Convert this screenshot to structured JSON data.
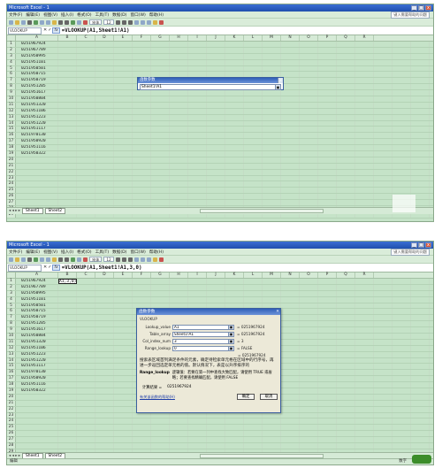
{
  "shot1": {
    "title": "Microsoft Excel - 1",
    "menu": [
      "文件(F)",
      "编辑(E)",
      "视图(V)",
      "插入(I)",
      "格式(O)",
      "工具(T)",
      "数据(D)",
      "窗口(W)",
      "帮助(H)"
    ],
    "help_box": "键入需要帮助的问题",
    "font_select": "宋体",
    "size_select": "12",
    "name_box": "VLOOKUP",
    "formula": "=VLOOKUP(A1,Sheet1!A1)",
    "columns": [
      "A",
      "B",
      "C",
      "D",
      "E",
      "F",
      "G",
      "H",
      "I",
      "J",
      "K",
      "L",
      "M",
      "N",
      "O",
      "P",
      "Q",
      "R"
    ],
    "rows": [
      "1",
      "2",
      "3",
      "4",
      "5",
      "6",
      "7",
      "8",
      "9",
      "10",
      "11",
      "12",
      "13",
      "14",
      "15",
      "16",
      "17",
      "18",
      "19",
      "20",
      "21",
      "22",
      "23",
      "24",
      "25",
      "26",
      "27",
      "28",
      "29",
      "30",
      "31",
      "32",
      "33"
    ],
    "cells_a": [
      "0251967924",
      "0251967789",
      "0251950995",
      "0251951101",
      "0251950501",
      "0251950715",
      "0251950719",
      "0251951205",
      "0251951617",
      "0251950804",
      "0251951320",
      "0251951106",
      "0251951223",
      "0251951220",
      "0251951117",
      "0251970130",
      "0251950920",
      "0251951116",
      "0251950322"
    ],
    "popup": {
      "title": "函数参数",
      "value": "Sheet1!A1"
    },
    "tabs": [
      "Sheet1",
      "Sheet2"
    ],
    "tab_nav": "◂ ◂ ▸ ▸"
  },
  "shot2": {
    "title": "Microsoft Excel - 1",
    "menu": [
      "文件(F)",
      "编辑(E)",
      "视图(V)",
      "插入(I)",
      "格式(O)",
      "工具(T)",
      "数据(D)",
      "窗口(W)",
      "帮助(H)"
    ],
    "help_box": "键入需要帮助的问题",
    "font_select": "宋体",
    "size_select": "12",
    "name_box": "VLOOKUP",
    "formula": "=VLOOKUP(A1,Sheet1!A1,3,0)",
    "active_cell_text": "A1,3,0)",
    "columns": [
      "A",
      "B",
      "C",
      "D",
      "E",
      "F",
      "G",
      "H",
      "I",
      "J",
      "K",
      "L",
      "M",
      "N",
      "O",
      "P",
      "Q",
      "R"
    ],
    "rows": [
      "1",
      "2",
      "3",
      "4",
      "5",
      "6",
      "7",
      "8",
      "9",
      "10",
      "11",
      "12",
      "13",
      "14",
      "15",
      "16",
      "17",
      "18",
      "19",
      "20",
      "21",
      "22",
      "23",
      "24",
      "25",
      "26",
      "27",
      "28",
      "29",
      "30",
      "31",
      "32",
      "33"
    ],
    "cells_a": [
      "0251967924",
      "0251967789",
      "0251950995",
      "0251951101",
      "0251950501",
      "0251950715",
      "0251950719",
      "0251951205",
      "0251951617",
      "0251950804",
      "0251951320",
      "0251951106",
      "0251951223",
      "0251951220",
      "0251951117",
      "0251970130",
      "0251950920",
      "0251951116",
      "0251950322"
    ],
    "dialog": {
      "title": "函数参数",
      "group": "VLOOKUP",
      "args": [
        {
          "label": "Lookup_value",
          "value": "A1",
          "result": "= 0251967924"
        },
        {
          "label": "Table_array",
          "value": "Sheet1!A1",
          "result": "= 0251967924"
        },
        {
          "label": "Col_index_num",
          "value": "3",
          "result": "= 3"
        },
        {
          "label": "Range_lookup",
          "value": "0",
          "result": "= FALSE"
        }
      ],
      "result_line": "= 0251967924",
      "description": "搜索表区域首列满足条件的元素，确定待检索单元格在区域中的行序号，再进一步返回选定单元格的值。默认情况下，表是以升序排序的",
      "detail_key": "Range_lookup",
      "detail_text": "逻辑值：若要在第一列中查找大致匹配，请使用 TRUE 或省略；若要查找精确匹配，请使用 FALSE",
      "calc_label": "计算结果 =",
      "calc_value": "0251967924",
      "help_link": "有关该函数的帮助(H)",
      "ok": "确定",
      "cancel": "取消"
    },
    "tabs": [
      "Sheet1",
      "Sheet2"
    ],
    "tab_nav": "◂ ◂ ▸ ▸",
    "status_left": "编辑",
    "status_right": "数字"
  }
}
